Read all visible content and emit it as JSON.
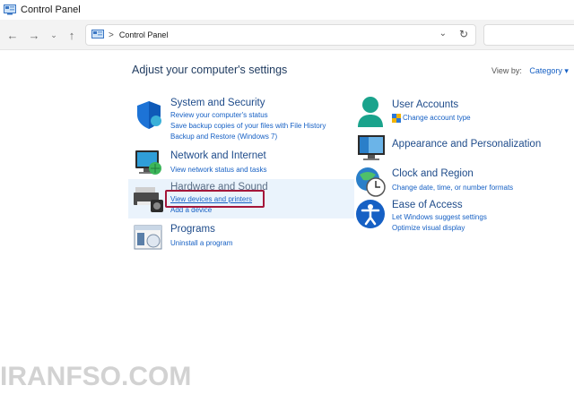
{
  "window": {
    "title": "Control Panel"
  },
  "nav": {
    "back_icon": "arrow-left-icon",
    "forward_icon": "arrow-right-icon",
    "recent_icon": "chevron-down-icon",
    "up_icon": "arrow-up-icon",
    "address": {
      "crumb": "Control Panel",
      "separator": ">"
    }
  },
  "content": {
    "heading": "Adjust your computer's settings",
    "view_by_label": "View by:",
    "view_by_value": "Category",
    "view_by_arrow": "▾"
  },
  "categories": {
    "system": {
      "title": "System and Security",
      "links": [
        "Review your computer's status",
        "Save backup copies of your files with File History",
        "Backup and Restore (Windows 7)"
      ]
    },
    "network": {
      "title": "Network and Internet",
      "links": [
        "View network status and tasks"
      ]
    },
    "hardware": {
      "title": "Hardware and Sound",
      "links": [
        "View devices and printers",
        "Add a device"
      ]
    },
    "programs": {
      "title": "Programs",
      "links": [
        "Uninstall a program"
      ]
    },
    "accounts": {
      "title": "User Accounts",
      "links": [
        "Change account type"
      ]
    },
    "appearance": {
      "title": "Appearance and Personalization",
      "links": []
    },
    "clock": {
      "title": "Clock and Region",
      "links": [
        "Change date, time, or number formats"
      ]
    },
    "ease": {
      "title": "Ease of Access",
      "links": [
        "Let Windows suggest settings",
        "Optimize visual display"
      ]
    }
  },
  "watermark": "IRANFSO.COM",
  "colors": {
    "link": "#1660c4",
    "title": "#1e4b8a",
    "highlight": "#a4163a",
    "hover": "#eaf3fc"
  }
}
